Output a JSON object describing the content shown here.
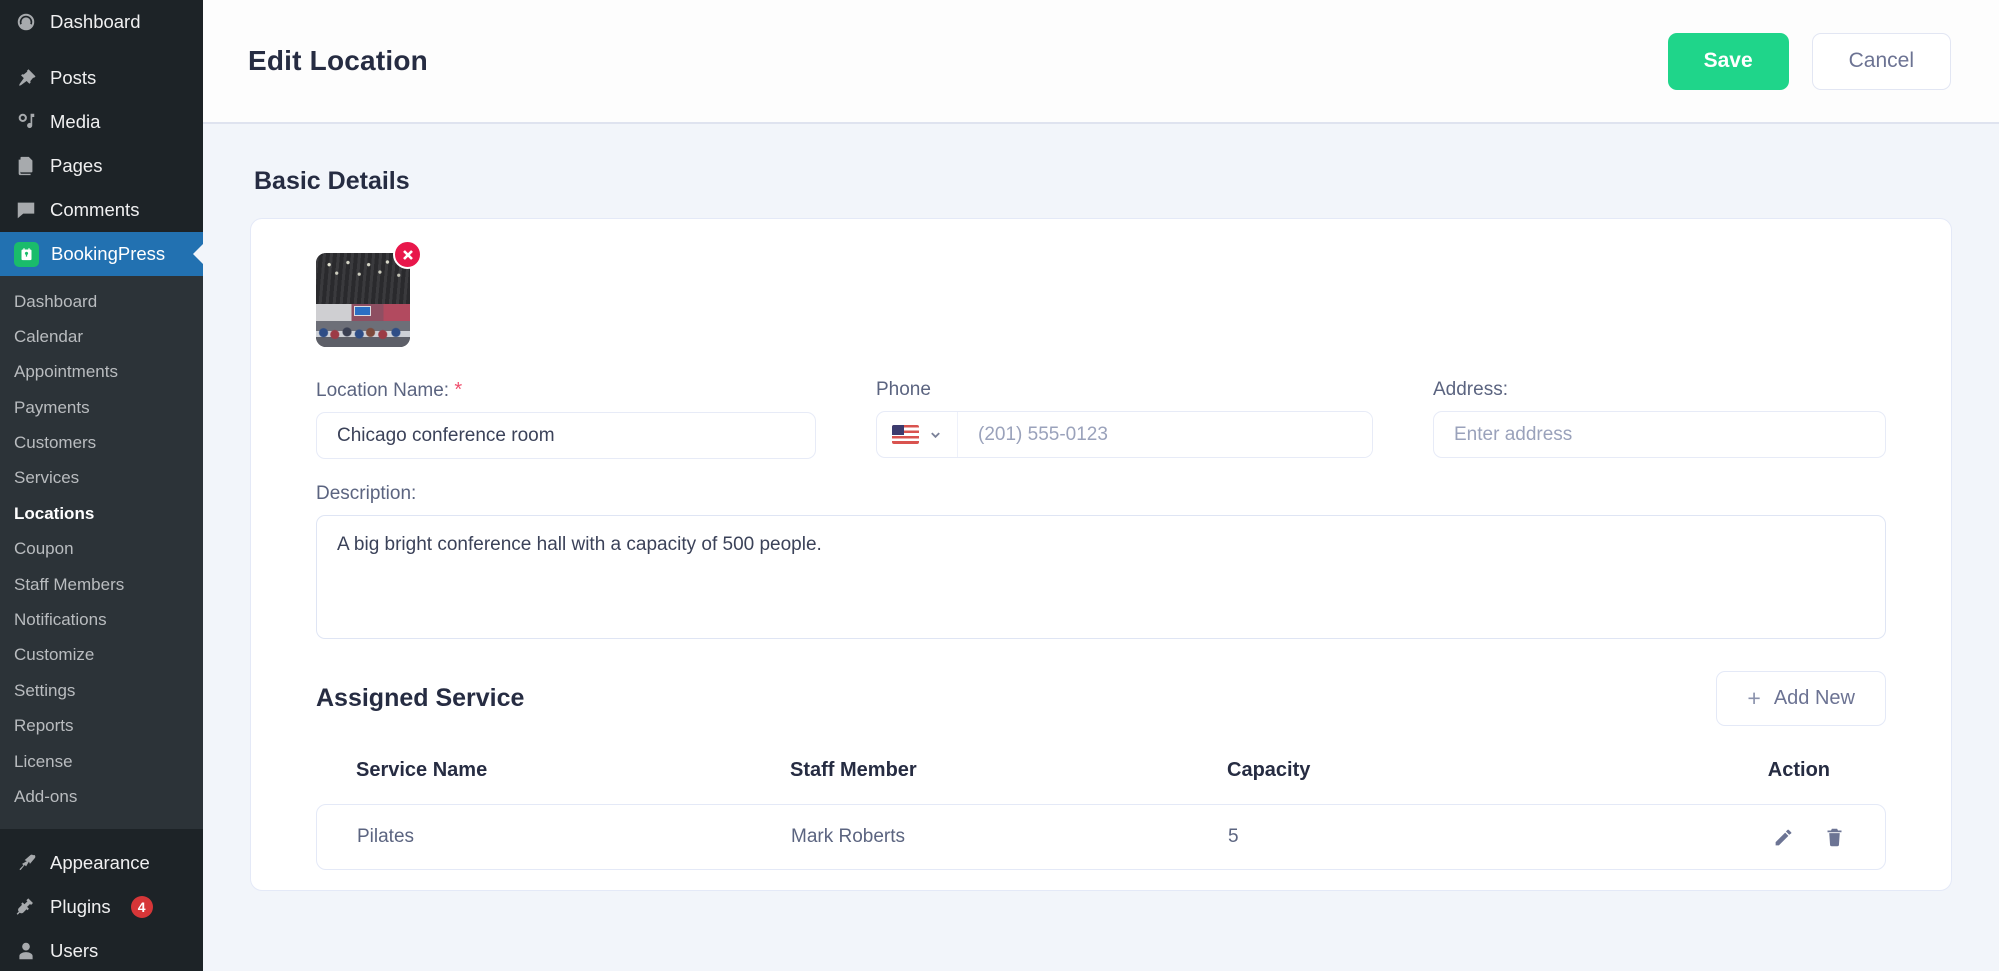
{
  "sidebar": {
    "wp_items": [
      {
        "label": "Dashboard",
        "icon": "dashboard-icon"
      },
      {
        "label": "Posts",
        "icon": "pin-icon"
      },
      {
        "label": "Media",
        "icon": "media-icon"
      },
      {
        "label": "Pages",
        "icon": "pages-icon"
      },
      {
        "label": "Comments",
        "icon": "comments-icon"
      }
    ],
    "plugin": {
      "label": "BookingPress",
      "icon": "bookingpress-icon",
      "accent": "#1abc6b",
      "active_bg": "#2271b1"
    },
    "submenu": [
      "Dashboard",
      "Calendar",
      "Appointments",
      "Payments",
      "Customers",
      "Services",
      "Locations",
      "Coupon",
      "Staff Members",
      "Notifications",
      "Customize",
      "Settings",
      "Reports",
      "License",
      "Add-ons"
    ],
    "submenu_current": "Locations",
    "bottom_items": [
      {
        "label": "Appearance",
        "icon": "brush-icon",
        "badge": ""
      },
      {
        "label": "Plugins",
        "icon": "plug-icon",
        "badge": "4"
      },
      {
        "label": "Users",
        "icon": "user-icon",
        "badge": ""
      }
    ]
  },
  "header": {
    "title": "Edit Location",
    "save_label": "Save",
    "cancel_label": "Cancel",
    "save_color": "#1fd58a"
  },
  "basic_details": {
    "section_title": "Basic Details",
    "image": {
      "alt": "conference hall photo",
      "remove_label": "remove-image"
    },
    "location_name": {
      "label": "Location Name:",
      "required_mark": "*",
      "value": "Chicago conference room"
    },
    "phone": {
      "label": "Phone",
      "country": "US",
      "placeholder": "(201) 555-0123",
      "value": ""
    },
    "address": {
      "label": "Address:",
      "placeholder": "Enter address",
      "value": ""
    },
    "description": {
      "label": "Description:",
      "value": "A big bright conference hall with a capacity of 500 people."
    }
  },
  "assigned_service": {
    "title": "Assigned Service",
    "add_new_label": "Add New",
    "add_new_icon": "plus-icon",
    "columns": [
      "Service Name",
      "Staff Member",
      "Capacity",
      "Action"
    ],
    "rows": [
      {
        "service_name": "Pilates",
        "staff_member": "Mark Roberts",
        "capacity": "5",
        "edit_icon": "pencil-icon",
        "delete_icon": "trash-icon"
      }
    ]
  }
}
